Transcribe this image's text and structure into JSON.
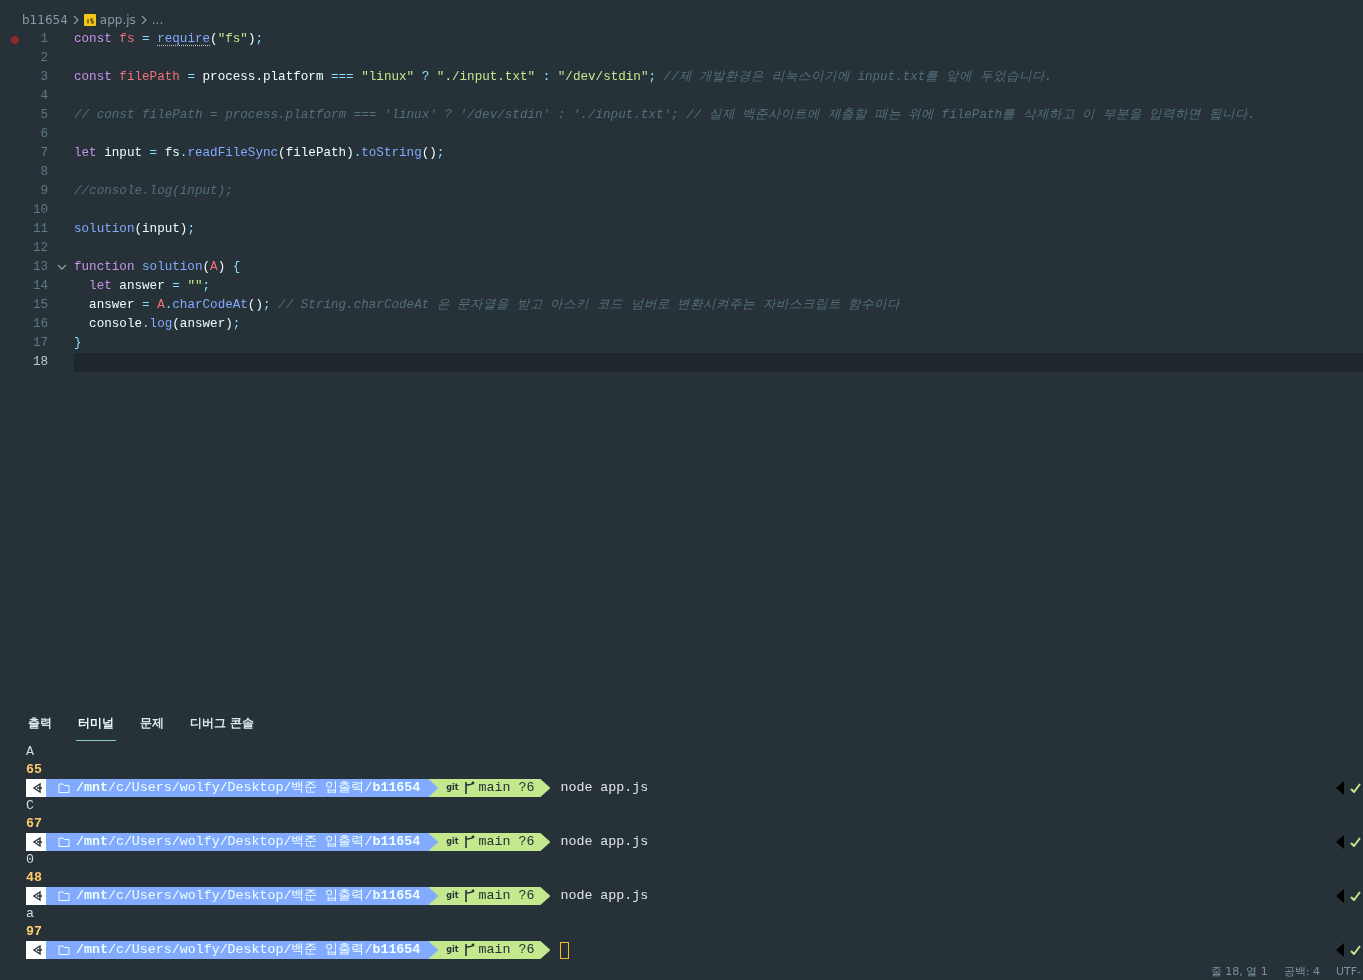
{
  "breadcrumb": {
    "folder": "b11654",
    "file": "app.js",
    "more": "..."
  },
  "editor": {
    "lines": [
      {
        "number": "1",
        "breakpoint": true,
        "foldable": false,
        "current": false,
        "tokens": [
          {
            "kind": "kw",
            "text": "const"
          },
          {
            "kind": "var",
            "text": " fs"
          },
          {
            "kind": "op",
            "text": " = "
          },
          {
            "kind": "hint",
            "text": "require"
          },
          {
            "kind": "plain",
            "text": "("
          },
          {
            "kind": "str",
            "text": "\"fs\""
          },
          {
            "kind": "plain",
            "text": ")"
          },
          {
            "kind": "op",
            "text": ";"
          }
        ]
      },
      {
        "number": "2",
        "breakpoint": false,
        "foldable": false,
        "current": false
      },
      {
        "number": "3",
        "breakpoint": false,
        "foldable": false,
        "current": false,
        "tokens": [
          {
            "kind": "kw",
            "text": "const"
          },
          {
            "kind": "var",
            "text": " filePath"
          },
          {
            "kind": "op",
            "text": " = "
          },
          {
            "kind": "plain",
            "text": "process.platform "
          },
          {
            "kind": "op",
            "text": "==="
          },
          {
            "kind": "str",
            "text": " \"linux\""
          },
          {
            "kind": "op",
            "text": " ? "
          },
          {
            "kind": "str",
            "text": "\"./input.txt\""
          },
          {
            "kind": "op",
            "text": " : "
          },
          {
            "kind": "str",
            "text": "\"/dev/stdin\""
          },
          {
            "kind": "op",
            "text": ";"
          },
          {
            "kind": "cm",
            "text": " //제 개발환경은 리눅스이기에 input.txt를 앞에 두었습니다."
          }
        ]
      },
      {
        "number": "4",
        "breakpoint": false,
        "foldable": false,
        "current": false
      },
      {
        "number": "5",
        "breakpoint": false,
        "foldable": false,
        "current": false,
        "tokens": [
          {
            "kind": "cm",
            "text": "// const filePath = process.platform === 'linux' ? '/dev/stdin' : './input.txt'; // 실제 백준사이트에 제출할 때는 위에 filePath를 삭제하고 이 부분을 입력하면 됩니다."
          }
        ]
      },
      {
        "number": "6",
        "breakpoint": false,
        "foldable": false,
        "current": false
      },
      {
        "number": "7",
        "breakpoint": false,
        "foldable": false,
        "current": false,
        "tokens": [
          {
            "kind": "kw",
            "text": "let"
          },
          {
            "kind": "plain",
            "text": " input "
          },
          {
            "kind": "op",
            "text": "="
          },
          {
            "kind": "plain",
            "text": " fs"
          },
          {
            "kind": "op",
            "text": "."
          },
          {
            "kind": "fn",
            "text": "readFileSync"
          },
          {
            "kind": "plain",
            "text": "(filePath)"
          },
          {
            "kind": "op",
            "text": "."
          },
          {
            "kind": "fn",
            "text": "toString"
          },
          {
            "kind": "plain",
            "text": "()"
          },
          {
            "kind": "op",
            "text": ";"
          }
        ]
      },
      {
        "number": "8",
        "breakpoint": false,
        "foldable": false,
        "current": false
      },
      {
        "number": "9",
        "breakpoint": false,
        "foldable": false,
        "current": false,
        "tokens": [
          {
            "kind": "cm",
            "text": "//console.log(input);"
          }
        ]
      },
      {
        "number": "10",
        "breakpoint": false,
        "foldable": false,
        "current": false
      },
      {
        "number": "11",
        "breakpoint": false,
        "foldable": false,
        "current": false,
        "tokens": [
          {
            "kind": "fn",
            "text": "solution"
          },
          {
            "kind": "plain",
            "text": "(input)"
          },
          {
            "kind": "op",
            "text": ";"
          }
        ]
      },
      {
        "number": "12",
        "breakpoint": false,
        "foldable": false,
        "current": false
      },
      {
        "number": "13",
        "breakpoint": false,
        "foldable": true,
        "current": false,
        "tokens": [
          {
            "kind": "kw",
            "text": "function"
          },
          {
            "kind": "fn",
            "text": " solution"
          },
          {
            "kind": "plain",
            "text": "("
          },
          {
            "kind": "var",
            "text": "A"
          },
          {
            "kind": "plain",
            "text": ") "
          },
          {
            "kind": "op",
            "text": "{"
          }
        ]
      },
      {
        "number": "14",
        "breakpoint": false,
        "foldable": false,
        "current": false,
        "tokens": [
          {
            "kind": "kw",
            "text": "  let"
          },
          {
            "kind": "plain",
            "text": " answer "
          },
          {
            "kind": "op",
            "text": "="
          },
          {
            "kind": "str",
            "text": " \"\""
          },
          {
            "kind": "op",
            "text": ";"
          }
        ]
      },
      {
        "number": "15",
        "breakpoint": false,
        "foldable": false,
        "current": false,
        "tokens": [
          {
            "kind": "plain",
            "text": "  answer "
          },
          {
            "kind": "op",
            "text": "="
          },
          {
            "kind": "var",
            "text": " A"
          },
          {
            "kind": "op",
            "text": "."
          },
          {
            "kind": "fn",
            "text": "charCodeAt"
          },
          {
            "kind": "plain",
            "text": "()"
          },
          {
            "kind": "op",
            "text": ";"
          },
          {
            "kind": "cm",
            "text": " // String.charCodeAt 은 문자열을 받고 아스키 코드 넘버로 변환시켜주는 자바스크립트 함수이다"
          }
        ]
      },
      {
        "number": "16",
        "breakpoint": false,
        "foldable": false,
        "current": false,
        "tokens": [
          {
            "kind": "plain",
            "text": "  console"
          },
          {
            "kind": "op",
            "text": "."
          },
          {
            "kind": "fn",
            "text": "log"
          },
          {
            "kind": "plain",
            "text": "(answer)"
          },
          {
            "kind": "op",
            "text": ";"
          }
        ]
      },
      {
        "number": "17",
        "breakpoint": false,
        "foldable": false,
        "current": false,
        "tokens": [
          {
            "kind": "op",
            "text": "}"
          }
        ]
      },
      {
        "number": "18",
        "breakpoint": false,
        "foldable": false,
        "current": true
      }
    ]
  },
  "panel": {
    "tabs": [
      {
        "label": "출력",
        "selected": false
      },
      {
        "label": "터미널",
        "selected": true
      },
      {
        "label": "문제",
        "selected": false
      },
      {
        "label": "디버그 콘솔",
        "selected": false
      }
    ],
    "terminal": [
      {
        "kind": "echo",
        "text": "A"
      },
      {
        "kind": "value",
        "text": "65"
      },
      {
        "kind": "prompt",
        "path": "**/mnt**/c/Users/wolfy/Desktop/백준 입출력/**b11654**",
        "vcs": "git",
        "branch": "main ?6",
        "command": "node app.js",
        "cursor": false
      },
      {
        "kind": "echo",
        "text": "C"
      },
      {
        "kind": "value",
        "text": "67"
      },
      {
        "kind": "prompt",
        "path": "**/mnt**/c/Users/wolfy/Desktop/백준 입출력/**b11654**",
        "vcs": "git",
        "branch": "main ?6",
        "command": "node app.js",
        "cursor": false
      },
      {
        "kind": "echo",
        "text": "0"
      },
      {
        "kind": "value",
        "text": "48"
      },
      {
        "kind": "prompt",
        "path": "**/mnt**/c/Users/wolfy/Desktop/백준 입출력/**b11654**",
        "vcs": "git",
        "branch": "main ?6",
        "command": "node app.js",
        "cursor": false
      },
      {
        "kind": "echo",
        "text": "a"
      },
      {
        "kind": "value",
        "text": "97"
      },
      {
        "kind": "prompt",
        "path": "**/mnt**/c/Users/wolfy/Desktop/백준 입출력/**b11654**",
        "vcs": "git",
        "branch": "main ?6",
        "cursor": true
      }
    ]
  },
  "status_bar": [
    "줄 18, 열 1",
    "공백: 4",
    "UTF-"
  ]
}
